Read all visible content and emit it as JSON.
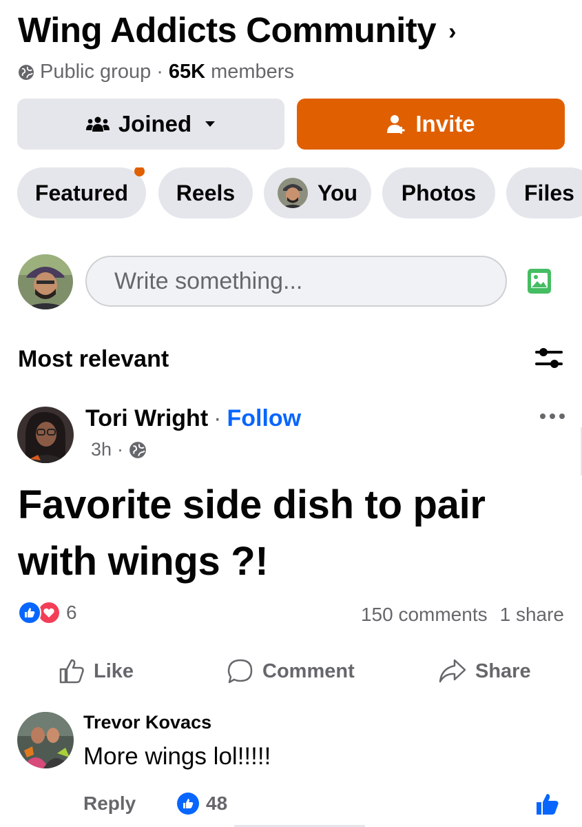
{
  "group": {
    "name": "Wing Addicts Community",
    "chevron": "›",
    "privacy": "Public group",
    "separator": "·",
    "member_count": "65K",
    "member_suffix": "members"
  },
  "actions": {
    "joined_label": "Joined",
    "invite_label": "Invite"
  },
  "tabs": [
    {
      "label": "Featured",
      "has_dot": true
    },
    {
      "label": "Reels"
    },
    {
      "label": "You",
      "has_avatar": true
    },
    {
      "label": "Photos"
    },
    {
      "label": "Files"
    }
  ],
  "composer": {
    "placeholder": "Write something..."
  },
  "feed": {
    "sort_label": "Most relevant"
  },
  "post": {
    "author": "Tori Wright",
    "separator": "·",
    "follow_label": "Follow",
    "time": "3h",
    "text": "Favorite side dish to pair with wings ?!",
    "reaction_count": "6",
    "comments": "150 comments",
    "shares": "1 share",
    "like_label": "Like",
    "comment_label": "Comment",
    "share_label": "Share"
  },
  "comment": {
    "author": "Trevor Kovacs",
    "text": "More wings lol!!!!!",
    "reply_label": "Reply",
    "like_count": "48"
  },
  "colors": {
    "accent": "#e05f00",
    "link": "#0866ff",
    "chip_bg": "#e4e6eb",
    "muted_text": "#65676b",
    "love": "#f33e58",
    "photo_green": "#45bd62"
  }
}
